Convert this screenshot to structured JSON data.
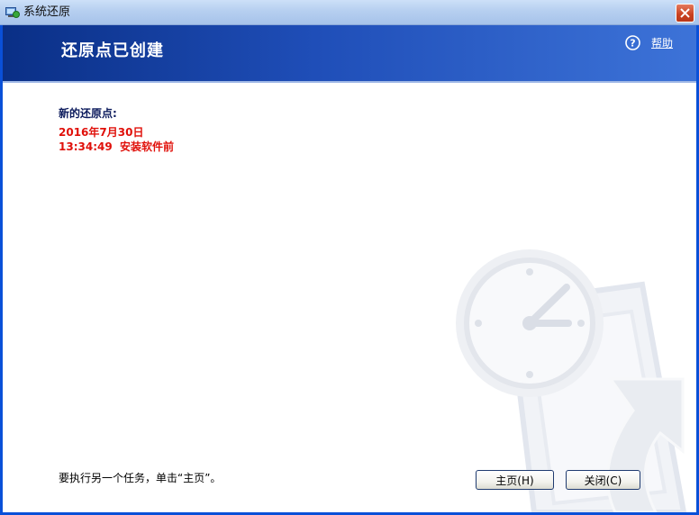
{
  "window": {
    "title": "系统还原",
    "close_icon": "close-x-icon"
  },
  "header": {
    "title": "还原点已创建",
    "help_label": "帮助",
    "help_icon": "question-circle-icon"
  },
  "content": {
    "new_restore_point_label": "新的还原点:",
    "restore_point_date": "2016年7月30日",
    "restore_point_time_and_name": "13:34:49  安装软件前",
    "instruction": "要执行另一个任务，单击“主页”。"
  },
  "buttons": {
    "home": "主页(H)",
    "close": "关闭(C)"
  },
  "colors": {
    "header_dark": "#0a2f86",
    "header_light": "#3d73d8",
    "highlight_red": "#e0100a",
    "label_navy": "#0b1a5c"
  }
}
